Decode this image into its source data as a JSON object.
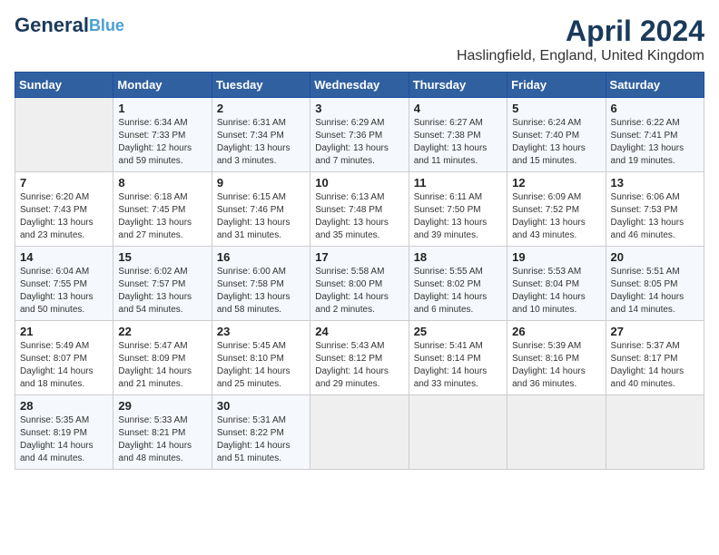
{
  "logo": {
    "line1": "General",
    "line2": "Blue"
  },
  "title": "April 2024",
  "location": "Haslingfield, England, United Kingdom",
  "days_of_week": [
    "Sunday",
    "Monday",
    "Tuesday",
    "Wednesday",
    "Thursday",
    "Friday",
    "Saturday"
  ],
  "weeks": [
    [
      {
        "day": "",
        "info": ""
      },
      {
        "day": "1",
        "info": "Sunrise: 6:34 AM\nSunset: 7:33 PM\nDaylight: 12 hours\nand 59 minutes."
      },
      {
        "day": "2",
        "info": "Sunrise: 6:31 AM\nSunset: 7:34 PM\nDaylight: 13 hours\nand 3 minutes."
      },
      {
        "day": "3",
        "info": "Sunrise: 6:29 AM\nSunset: 7:36 PM\nDaylight: 13 hours\nand 7 minutes."
      },
      {
        "day": "4",
        "info": "Sunrise: 6:27 AM\nSunset: 7:38 PM\nDaylight: 13 hours\nand 11 minutes."
      },
      {
        "day": "5",
        "info": "Sunrise: 6:24 AM\nSunset: 7:40 PM\nDaylight: 13 hours\nand 15 minutes."
      },
      {
        "day": "6",
        "info": "Sunrise: 6:22 AM\nSunset: 7:41 PM\nDaylight: 13 hours\nand 19 minutes."
      }
    ],
    [
      {
        "day": "7",
        "info": "Sunrise: 6:20 AM\nSunset: 7:43 PM\nDaylight: 13 hours\nand 23 minutes."
      },
      {
        "day": "8",
        "info": "Sunrise: 6:18 AM\nSunset: 7:45 PM\nDaylight: 13 hours\nand 27 minutes."
      },
      {
        "day": "9",
        "info": "Sunrise: 6:15 AM\nSunset: 7:46 PM\nDaylight: 13 hours\nand 31 minutes."
      },
      {
        "day": "10",
        "info": "Sunrise: 6:13 AM\nSunset: 7:48 PM\nDaylight: 13 hours\nand 35 minutes."
      },
      {
        "day": "11",
        "info": "Sunrise: 6:11 AM\nSunset: 7:50 PM\nDaylight: 13 hours\nand 39 minutes."
      },
      {
        "day": "12",
        "info": "Sunrise: 6:09 AM\nSunset: 7:52 PM\nDaylight: 13 hours\nand 43 minutes."
      },
      {
        "day": "13",
        "info": "Sunrise: 6:06 AM\nSunset: 7:53 PM\nDaylight: 13 hours\nand 46 minutes."
      }
    ],
    [
      {
        "day": "14",
        "info": "Sunrise: 6:04 AM\nSunset: 7:55 PM\nDaylight: 13 hours\nand 50 minutes."
      },
      {
        "day": "15",
        "info": "Sunrise: 6:02 AM\nSunset: 7:57 PM\nDaylight: 13 hours\nand 54 minutes."
      },
      {
        "day": "16",
        "info": "Sunrise: 6:00 AM\nSunset: 7:58 PM\nDaylight: 13 hours\nand 58 minutes."
      },
      {
        "day": "17",
        "info": "Sunrise: 5:58 AM\nSunset: 8:00 PM\nDaylight: 14 hours\nand 2 minutes."
      },
      {
        "day": "18",
        "info": "Sunrise: 5:55 AM\nSunset: 8:02 PM\nDaylight: 14 hours\nand 6 minutes."
      },
      {
        "day": "19",
        "info": "Sunrise: 5:53 AM\nSunset: 8:04 PM\nDaylight: 14 hours\nand 10 minutes."
      },
      {
        "day": "20",
        "info": "Sunrise: 5:51 AM\nSunset: 8:05 PM\nDaylight: 14 hours\nand 14 minutes."
      }
    ],
    [
      {
        "day": "21",
        "info": "Sunrise: 5:49 AM\nSunset: 8:07 PM\nDaylight: 14 hours\nand 18 minutes."
      },
      {
        "day": "22",
        "info": "Sunrise: 5:47 AM\nSunset: 8:09 PM\nDaylight: 14 hours\nand 21 minutes."
      },
      {
        "day": "23",
        "info": "Sunrise: 5:45 AM\nSunset: 8:10 PM\nDaylight: 14 hours\nand 25 minutes."
      },
      {
        "day": "24",
        "info": "Sunrise: 5:43 AM\nSunset: 8:12 PM\nDaylight: 14 hours\nand 29 minutes."
      },
      {
        "day": "25",
        "info": "Sunrise: 5:41 AM\nSunset: 8:14 PM\nDaylight: 14 hours\nand 33 minutes."
      },
      {
        "day": "26",
        "info": "Sunrise: 5:39 AM\nSunset: 8:16 PM\nDaylight: 14 hours\nand 36 minutes."
      },
      {
        "day": "27",
        "info": "Sunrise: 5:37 AM\nSunset: 8:17 PM\nDaylight: 14 hours\nand 40 minutes."
      }
    ],
    [
      {
        "day": "28",
        "info": "Sunrise: 5:35 AM\nSunset: 8:19 PM\nDaylight: 14 hours\nand 44 minutes."
      },
      {
        "day": "29",
        "info": "Sunrise: 5:33 AM\nSunset: 8:21 PM\nDaylight: 14 hours\nand 48 minutes."
      },
      {
        "day": "30",
        "info": "Sunrise: 5:31 AM\nSunset: 8:22 PM\nDaylight: 14 hours\nand 51 minutes."
      },
      {
        "day": "",
        "info": ""
      },
      {
        "day": "",
        "info": ""
      },
      {
        "day": "",
        "info": ""
      },
      {
        "day": "",
        "info": ""
      }
    ]
  ]
}
